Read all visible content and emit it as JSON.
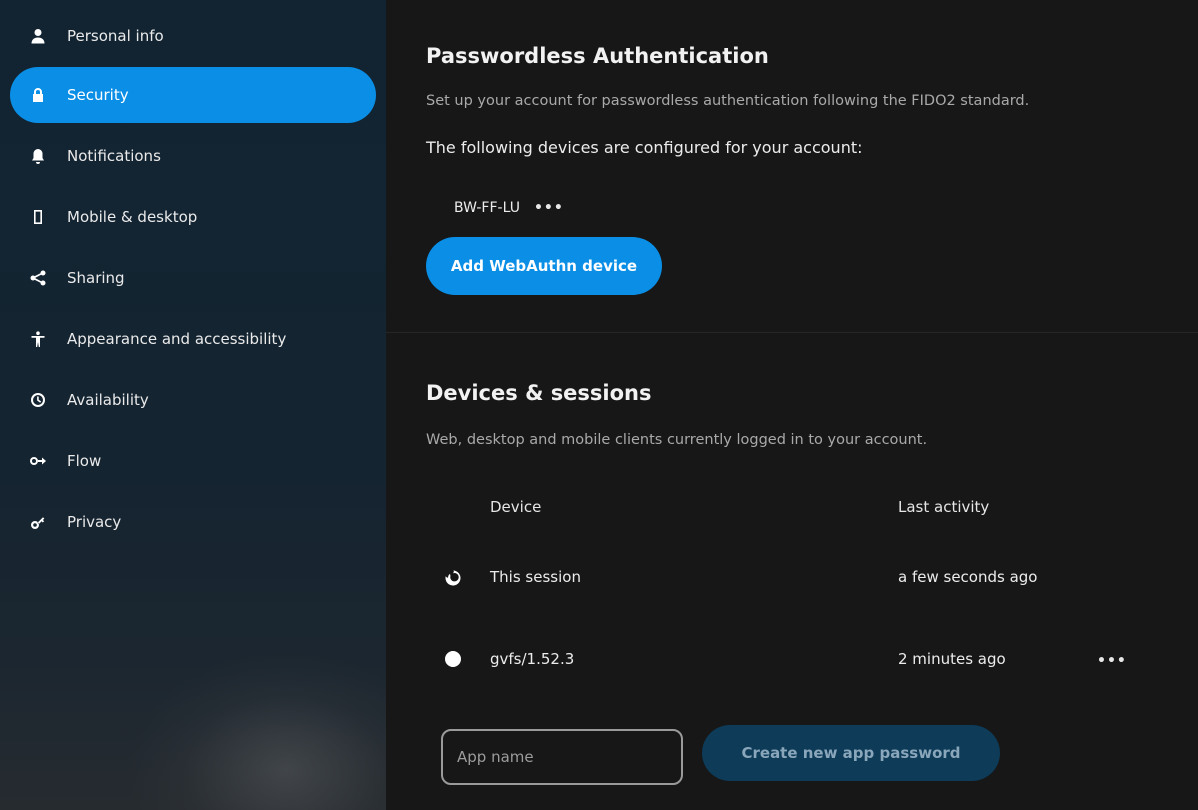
{
  "sidebar": {
    "items": [
      {
        "label": "Personal info",
        "icon": "user-icon"
      },
      {
        "label": "Security",
        "icon": "lock-icon",
        "active": true
      },
      {
        "label": "Notifications",
        "icon": "bell-icon"
      },
      {
        "label": "Mobile & desktop",
        "icon": "phone-icon"
      },
      {
        "label": "Sharing",
        "icon": "share-icon"
      },
      {
        "label": "Appearance and accessibility",
        "icon": "accessibility-icon"
      },
      {
        "label": "Availability",
        "icon": "clock-icon"
      },
      {
        "label": "Flow",
        "icon": "flow-icon"
      },
      {
        "label": "Privacy",
        "icon": "key-icon"
      }
    ]
  },
  "passwordless": {
    "title": "Passwordless Authentication",
    "description": "Set up your account for passwordless authentication following the FIDO2 standard.",
    "configured_text": "The following devices are configured for your account:",
    "device_name": "BW-FF-LU",
    "more_label": "•••",
    "add_button": "Add WebAuthn device"
  },
  "sessions": {
    "title": "Devices & sessions",
    "description": "Web, desktop and mobile clients currently logged in to your account.",
    "columns": {
      "device": "Device",
      "last_activity": "Last activity"
    },
    "rows": [
      {
        "device": "This session",
        "last_activity": "a few seconds ago",
        "icon": "firefox-icon"
      },
      {
        "device": "gvfs/1.52.3",
        "last_activity": "2 minutes ago",
        "icon": "globe-icon",
        "more_label": "•••"
      }
    ],
    "app_name_placeholder": "App name",
    "create_button": "Create new app password"
  },
  "colors": {
    "accent": "#0a8ee6",
    "background": "#171717",
    "sidebar": "#142431"
  }
}
